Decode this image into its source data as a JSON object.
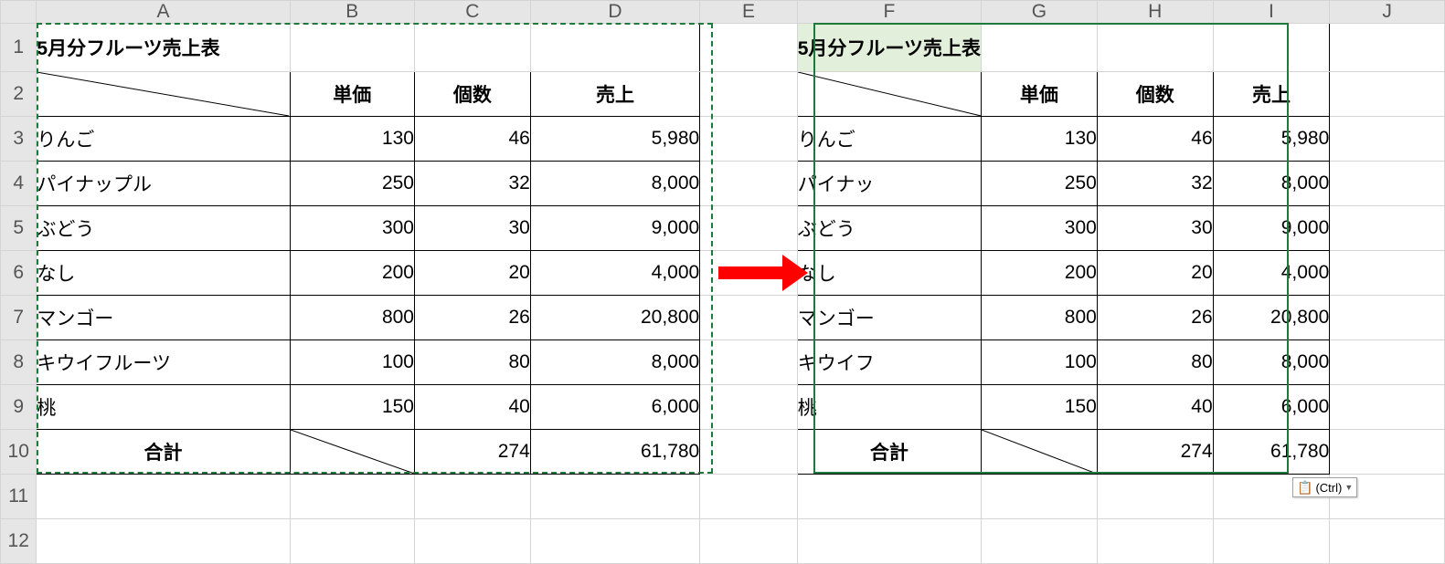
{
  "columns": [
    "A",
    "B",
    "C",
    "D",
    "E",
    "F",
    "G",
    "H",
    "I",
    "J"
  ],
  "colWidths": {
    "A": 280,
    "B": 140,
    "C": 130,
    "D": 190,
    "E": 110,
    "F": 130,
    "G": 130,
    "H": 130,
    "I": 130,
    "J": 130
  },
  "rows": [
    "1",
    "2",
    "3",
    "4",
    "5",
    "6",
    "7",
    "8",
    "9",
    "10",
    "11",
    "12"
  ],
  "source": {
    "title": "5月分フルーツ売上表",
    "headers": {
      "b": "単価",
      "c": "個数",
      "d": "売上"
    },
    "items": [
      {
        "name": "りんご",
        "price": "130",
        "qty": "46",
        "sales": "5,980"
      },
      {
        "name": "パイナップル",
        "price": "250",
        "qty": "32",
        "sales": "8,000"
      },
      {
        "name": "ぶどう",
        "price": "300",
        "qty": "30",
        "sales": "9,000"
      },
      {
        "name": "なし",
        "price": "200",
        "qty": "20",
        "sales": "4,000"
      },
      {
        "name": "マンゴー",
        "price": "800",
        "qty": "26",
        "sales": "20,800"
      },
      {
        "name": "キウイフルーツ",
        "price": "100",
        "qty": "80",
        "sales": "8,000"
      },
      {
        "name": "桃",
        "price": "150",
        "qty": "40",
        "sales": "6,000"
      }
    ],
    "total": {
      "label": "合計",
      "qty": "274",
      "sales": "61,780"
    }
  },
  "dest": {
    "title": "5月分フルーツ売上表",
    "headers": {
      "g": "単価",
      "h": "個数",
      "i": "売上"
    },
    "items": [
      {
        "name": "りんご",
        "price": "130",
        "qty": "46",
        "sales": "5,980"
      },
      {
        "name": "パイナッ",
        "price": "250",
        "qty": "32",
        "sales": "8,000"
      },
      {
        "name": "ぶどう",
        "price": "300",
        "qty": "30",
        "sales": "9,000"
      },
      {
        "name": "なし",
        "price": "200",
        "qty": "20",
        "sales": "4,000"
      },
      {
        "name": "マンゴー",
        "price": "800",
        "qty": "26",
        "sales": "20,800"
      },
      {
        "name": "キウイフ",
        "price": "100",
        "qty": "80",
        "sales": "8,000"
      },
      {
        "name": "桃",
        "price": "150",
        "qty": "40",
        "sales": "6,000"
      }
    ],
    "total": {
      "label": "合計",
      "qty": "274",
      "sales": "61,780"
    }
  },
  "smarttag": {
    "icon": "📋",
    "label": "(Ctrl)"
  }
}
